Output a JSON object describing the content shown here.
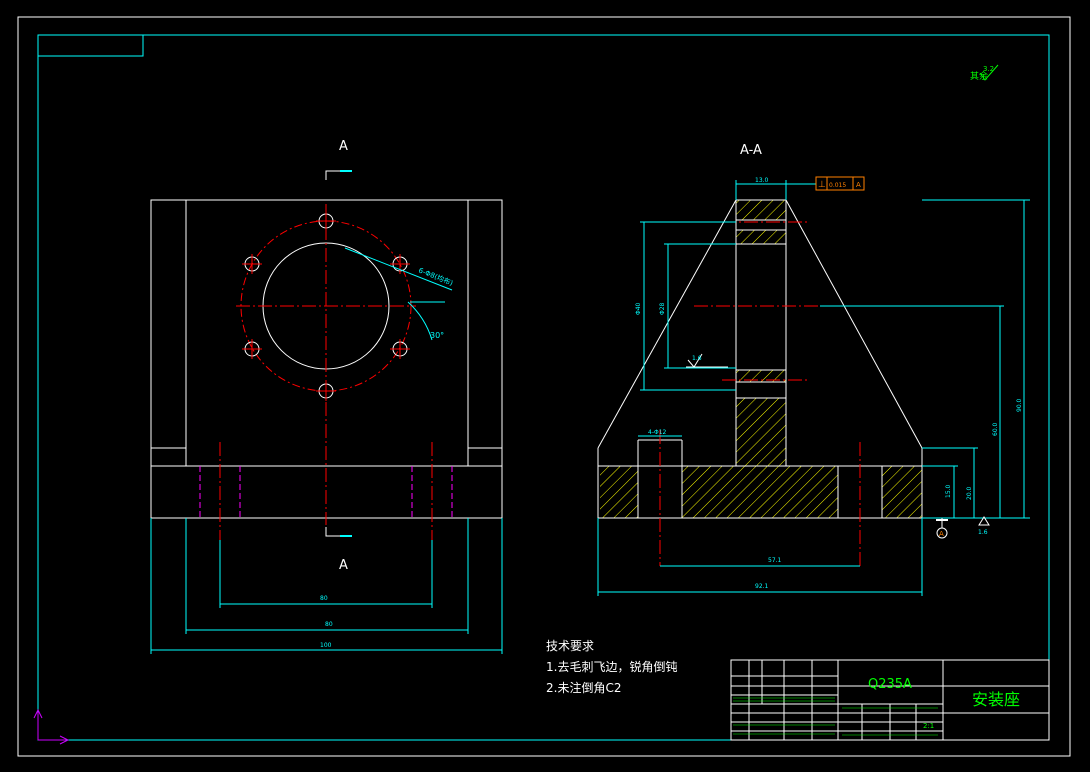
{
  "views": {
    "front_section_label_top": "A",
    "front_section_label_bottom": "A",
    "section_view_title": "A-A"
  },
  "surface_roughness": {
    "corner_text": "其余",
    "value": "3.2"
  },
  "front_dims": {
    "hole_note": "6-Φ8(均布)",
    "angle": "30°",
    "d80": "80",
    "d80b": "80",
    "d100": "100"
  },
  "section_dims": {
    "top_width": "13.0",
    "dia_outer": "Φ40",
    "dia_inner": "Φ28",
    "counterbore": "4-Φ12",
    "h15": "15.0",
    "h20": "20.0",
    "h60": "60.0",
    "h90": "90.0",
    "w57": "57.1",
    "w92": "92.1",
    "roughness_left": "1.6",
    "roughness_right": "1.6",
    "datum_letter": "A",
    "tolerance_symbol": "⊥",
    "tolerance_value": "0.015",
    "tolerance_datum": "A"
  },
  "tech_requirements": {
    "title": "技术要求",
    "item1": "1.去毛刺飞边，锐角倒钝",
    "item2": "2.未注倒角C2"
  },
  "title_block": {
    "material": "Q235A",
    "part_name": "安装座",
    "scale": "2:1"
  },
  "colors": {
    "border": "#00ffff",
    "outline": "#ffffff",
    "centerline": "#ff0000",
    "hidden": "#ff00ff",
    "hatch": "#ffff00",
    "title_text": "#00ff00",
    "tolerance": "#ff8000",
    "ucs": "#cc00ff"
  }
}
